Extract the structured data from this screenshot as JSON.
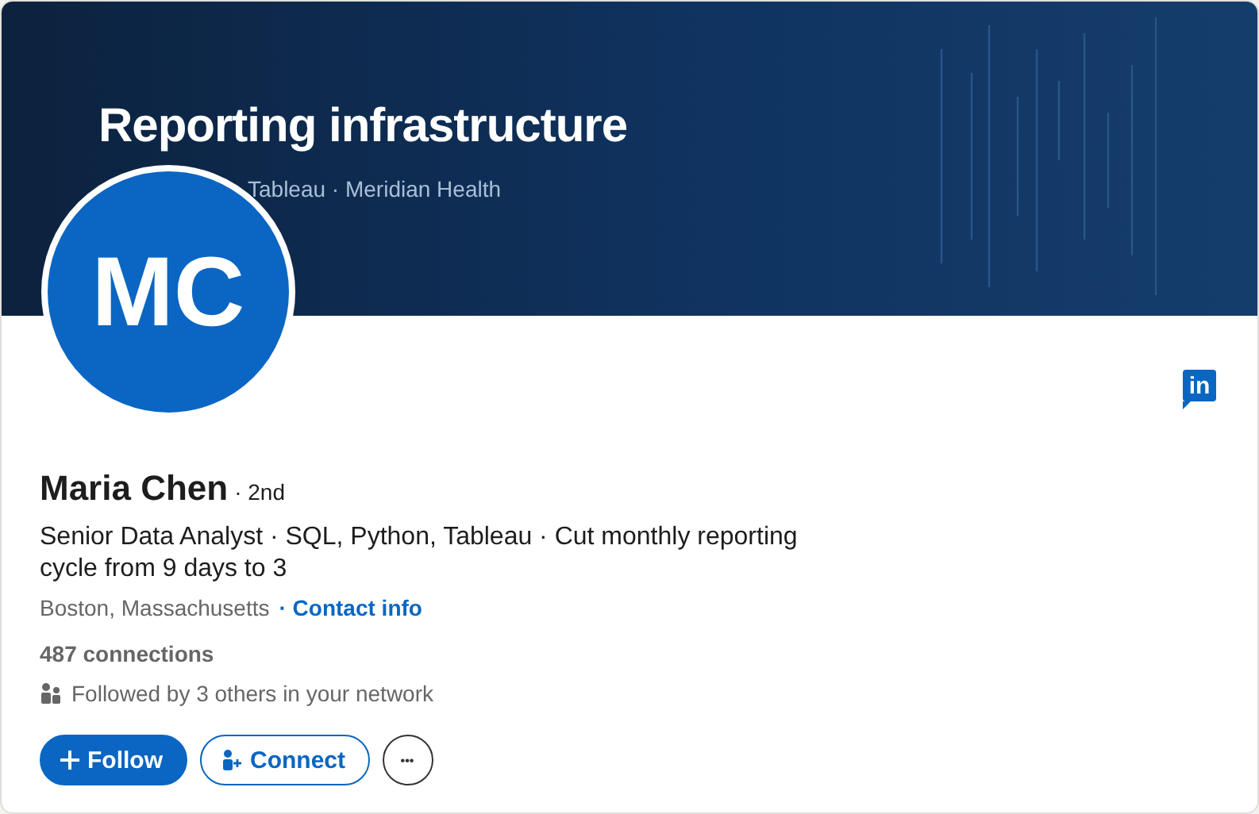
{
  "banner": {
    "title": "Reporting infrastructure",
    "subtitle": "Tableau · Meridian Health"
  },
  "avatar": {
    "initials": "MC"
  },
  "badge": {
    "text": "in"
  },
  "profile": {
    "name": "Maria Chen",
    "degree": "· 2nd",
    "headline": "Senior Data Analyst · SQL, Python, Tableau · Cut monthly reporting cycle from 9 days to 3",
    "location": "Boston, Massachusetts",
    "contact_link": "· Contact info",
    "connections": "487 connections",
    "followed_by": "Followed by 3 others in your network"
  },
  "actions": [
    {
      "kind": "primary",
      "label": "Follow"
    },
    {
      "kind": "outline",
      "label": "Connect"
    },
    {
      "kind": "more",
      "label": "•••"
    }
  ]
}
